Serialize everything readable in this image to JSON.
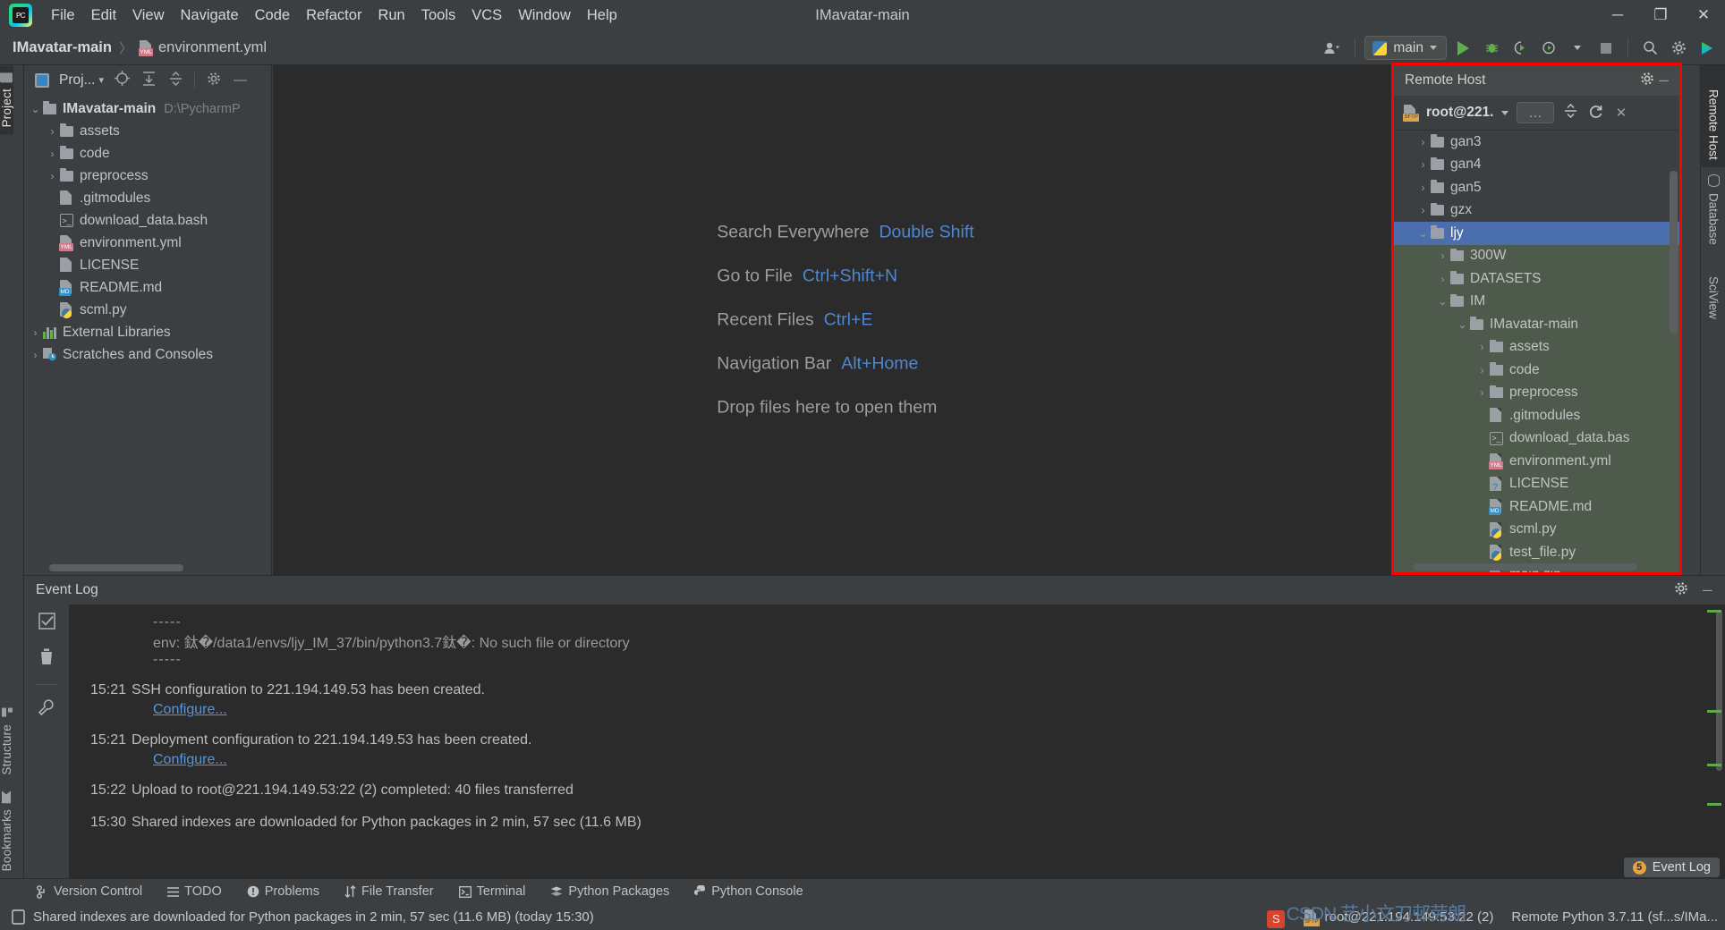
{
  "window": {
    "title": "IMavatar-main",
    "minimize_label": "─",
    "maximize_label": "❐",
    "close_label": "✕"
  },
  "menubar": {
    "logo_text": "PC",
    "items": [
      "File",
      "Edit",
      "View",
      "Navigate",
      "Code",
      "Refactor",
      "Run",
      "Tools",
      "VCS",
      "Window",
      "Help"
    ]
  },
  "breadcrumb": {
    "root": "IMavatar-main",
    "separator": "〉",
    "file": "environment.yml",
    "file_badge": "YML"
  },
  "toolbar_right": {
    "account_icon": "account-icon",
    "run_config": "main",
    "run_label": "▶",
    "debug_label": "debug-icon",
    "coverage_label": "coverage-icon",
    "profile_label": "profile-icon",
    "stop_label": "■",
    "search_label": "⌕",
    "settings_label": "⚙",
    "updates_label": "updates-icon"
  },
  "left_strip": {
    "top_tabs": [
      {
        "label": "Project",
        "icon": "folder-icon",
        "active": true
      }
    ],
    "bottom_tabs": [
      {
        "label": "Structure",
        "icon": "structure-icon",
        "active": false
      },
      {
        "label": "Bookmarks",
        "icon": "bookmark-icon",
        "active": false
      }
    ]
  },
  "right_strip": {
    "tabs": [
      {
        "label": "Remote Host",
        "icon": "remote-host-icon",
        "active": true
      },
      {
        "label": "Database",
        "icon": "database-icon",
        "active": false
      },
      {
        "label": "SciView",
        "icon": "sciview-icon",
        "active": false
      }
    ]
  },
  "project_panel": {
    "title": "Proj...",
    "title_caret": "▾",
    "toolbar_icons": [
      "locate-icon",
      "expand-all-icon",
      "collapse-all-icon",
      "gear-icon",
      "hide-icon"
    ],
    "tree": [
      {
        "indent": 0,
        "arrow": "⌄",
        "type": "folder",
        "label": "IMavatar-main",
        "bold": true,
        "path": "D:\\PycharmP"
      },
      {
        "indent": 1,
        "arrow": "›",
        "type": "folder",
        "label": "assets"
      },
      {
        "indent": 1,
        "arrow": "›",
        "type": "folder",
        "label": "code"
      },
      {
        "indent": 1,
        "arrow": "›",
        "type": "folder",
        "label": "preprocess"
      },
      {
        "indent": 1,
        "arrow": "",
        "type": "file",
        "label": ".gitmodules"
      },
      {
        "indent": 1,
        "arrow": "",
        "type": "bash",
        "label": "download_data.bash"
      },
      {
        "indent": 1,
        "arrow": "",
        "type": "yml",
        "label": "environment.yml"
      },
      {
        "indent": 1,
        "arrow": "",
        "type": "file",
        "label": "LICENSE"
      },
      {
        "indent": 1,
        "arrow": "",
        "type": "md",
        "label": "README.md"
      },
      {
        "indent": 1,
        "arrow": "",
        "type": "py",
        "label": "scml.py"
      },
      {
        "indent": 0,
        "arrow": "›",
        "type": "lib",
        "label": "External Libraries"
      },
      {
        "indent": 0,
        "arrow": "›",
        "type": "scratch",
        "label": "Scratches and Consoles"
      }
    ]
  },
  "editor": {
    "welcome_rows": [
      {
        "label": "Search Everywhere",
        "shortcut": "Double Shift"
      },
      {
        "label": "Go to File",
        "shortcut": "Ctrl+Shift+N"
      },
      {
        "label": "Recent Files",
        "shortcut": "Ctrl+E"
      },
      {
        "label": "Navigation Bar",
        "shortcut": "Alt+Home"
      },
      {
        "label": "Drop files here to open them",
        "shortcut": ""
      }
    ]
  },
  "remote_host": {
    "title": "Remote Host",
    "gear_label": "⚙",
    "hide_label": "─",
    "connection": "root@221.",
    "connection_caret": "▾",
    "browse_label": "...",
    "browse_icon": "ellipsis-icon",
    "collapse_icon": "collapse-all-icon",
    "refresh_icon": "↻",
    "close_icon": "✕",
    "sftp_badge": "SFTP",
    "tree": [
      {
        "indent": 1,
        "arrow": "›",
        "type": "folder",
        "label": "gan3",
        "state": "normal"
      },
      {
        "indent": 1,
        "arrow": "›",
        "type": "folder",
        "label": "gan4",
        "state": "normal"
      },
      {
        "indent": 1,
        "arrow": "›",
        "type": "folder",
        "label": "gan5",
        "state": "normal"
      },
      {
        "indent": 1,
        "arrow": "›",
        "type": "folder",
        "label": "gzx",
        "state": "normal"
      },
      {
        "indent": 1,
        "arrow": "⌄",
        "type": "folder",
        "label": "ljy",
        "state": "selected"
      },
      {
        "indent": 2,
        "arrow": "›",
        "type": "folder",
        "label": "300W",
        "state": "green"
      },
      {
        "indent": 2,
        "arrow": "›",
        "type": "folder",
        "label": "DATASETS",
        "state": "green"
      },
      {
        "indent": 2,
        "arrow": "⌄",
        "type": "folder",
        "label": "IM",
        "state": "green"
      },
      {
        "indent": 3,
        "arrow": "⌄",
        "type": "folder",
        "label": "IMavatar-main",
        "state": "green"
      },
      {
        "indent": 4,
        "arrow": "›",
        "type": "folder",
        "label": "assets",
        "state": "green"
      },
      {
        "indent": 4,
        "arrow": "›",
        "type": "folder",
        "label": "code",
        "state": "green"
      },
      {
        "indent": 4,
        "arrow": "›",
        "type": "folder",
        "label": "preprocess",
        "state": "green"
      },
      {
        "indent": 4,
        "arrow": "",
        "type": "file",
        "label": ".gitmodules",
        "state": "green"
      },
      {
        "indent": 4,
        "arrow": "",
        "type": "bash",
        "label": "download_data.bas",
        "state": "green"
      },
      {
        "indent": 4,
        "arrow": "",
        "type": "yml",
        "label": "environment.yml",
        "state": "green"
      },
      {
        "indent": 4,
        "arrow": "",
        "type": "unknown",
        "label": "LICENSE",
        "state": "green"
      },
      {
        "indent": 4,
        "arrow": "",
        "type": "md",
        "label": "README.md",
        "state": "green"
      },
      {
        "indent": 4,
        "arrow": "",
        "type": "py",
        "label": "scml.py",
        "state": "green"
      },
      {
        "indent": 4,
        "arrow": "",
        "type": "py",
        "label": "test_file.py",
        "state": "green"
      },
      {
        "indent": 4,
        "arrow": "",
        "type": "zip",
        "label": "main.zip",
        "state": "green"
      }
    ]
  },
  "event_log": {
    "title": "Event Log",
    "gear_label": "⚙",
    "hide_label": "─",
    "gutter_icons": [
      "mark-read-icon",
      "trash-icon",
      "settings-wrench-icon"
    ],
    "entries": [
      {
        "kind": "dash",
        "text": "-----"
      },
      {
        "kind": "plain",
        "text": "env: 鈦�/data1/envs/ljy_IM_37/bin/python3.7鈦�: No such file or directory"
      },
      {
        "kind": "dash",
        "text": "-----"
      },
      {
        "kind": "timed",
        "time": "15:21",
        "text": "SSH configuration to 221.194.149.53 has been created.",
        "link": "Configure..."
      },
      {
        "kind": "timed",
        "time": "15:21",
        "text": "Deployment configuration to 221.194.149.53 has been created.",
        "link": "Configure..."
      },
      {
        "kind": "timed",
        "time": "15:22",
        "text": "Upload to root@221.194.149.53:22 (2) completed: 40 files transferred",
        "link": ""
      },
      {
        "kind": "timed",
        "time": "15:30",
        "text": "Shared indexes are downloaded for Python packages in 2 min, 57 sec (11.6 MB)",
        "link": ""
      }
    ]
  },
  "bottom_toolbar": {
    "items": [
      {
        "label": "Version Control",
        "icon": "branch-icon"
      },
      {
        "label": "TODO",
        "icon": "list-icon"
      },
      {
        "label": "Problems",
        "icon": "warning-icon"
      },
      {
        "label": "File Transfer",
        "icon": "transfer-icon"
      },
      {
        "label": "Terminal",
        "icon": "terminal-icon"
      },
      {
        "label": "Python Packages",
        "icon": "packages-icon"
      },
      {
        "label": "Python Console",
        "icon": "python-icon"
      }
    ],
    "event_log_chip": {
      "label": "Event Log",
      "count": "5"
    }
  },
  "status_bar": {
    "message": "Shared indexes are downloaded for Python packages in 2 min, 57 sec (11.6 MB) (today 15:30)",
    "message_icon": "indexing-icon",
    "remote_interpreter": "root@221.194.149.53:22 (2)",
    "remote_badge": "SFTP",
    "python_interpreter": "Remote Python 3.7.11 (sf...s/IMa...",
    "watermark": "CSDN 艺小文刀邨劳朗"
  },
  "colors": {
    "accent_blue": "#4b6eaf",
    "link_blue": "#5a94d8",
    "shortcut_blue": "#4d87d4",
    "highlight_red": "#ff0000",
    "selected_green": "#4e5b4c",
    "panel_bg": "#3c3f41",
    "editor_bg": "#2b2b2b"
  }
}
